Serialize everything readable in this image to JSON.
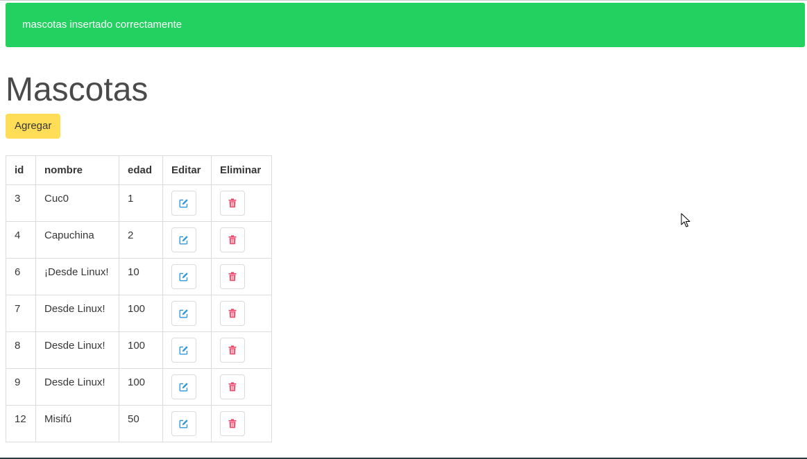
{
  "notification": {
    "message": "mascotas insertado correctamente",
    "color": "#23d160"
  },
  "page": {
    "title": "Mascotas",
    "add_button_label": "Agregar",
    "add_button_color": "#ffdd57"
  },
  "table": {
    "headers": {
      "id": "id",
      "nombre": "nombre",
      "edad": "edad",
      "editar": "Editar",
      "eliminar": "Eliminar"
    },
    "rows": [
      {
        "id": "3",
        "nombre": "Cuc0",
        "edad": "1"
      },
      {
        "id": "4",
        "nombre": "Capuchina",
        "edad": "2"
      },
      {
        "id": "6",
        "nombre": "¡Desde Linux!",
        "edad": "10"
      },
      {
        "id": "7",
        "nombre": "Desde Linux!",
        "edad": "100"
      },
      {
        "id": "8",
        "nombre": "Desde Linux!",
        "edad": "100"
      },
      {
        "id": "9",
        "nombre": "Desde Linux!",
        "edad": "100"
      },
      {
        "id": "12",
        "nombre": "Misifú",
        "edad": "50"
      }
    ],
    "edit_icon": "pencil-square-icon",
    "delete_icon": "trash-icon",
    "edit_icon_color": "#3298dc",
    "delete_icon_color": "#f14668"
  }
}
